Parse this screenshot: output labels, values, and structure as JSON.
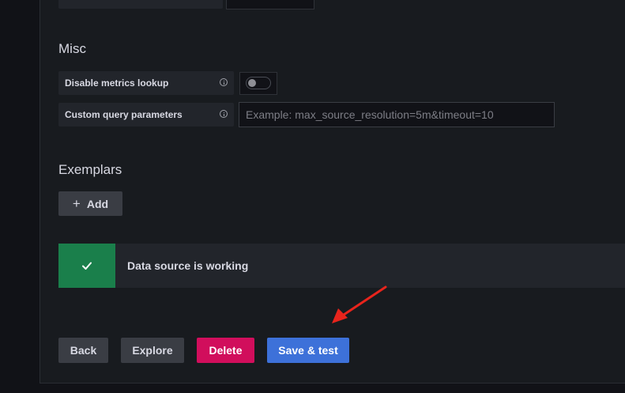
{
  "misc": {
    "title": "Misc",
    "disable_metrics_lookup_label": "Disable metrics lookup",
    "disable_metrics_lookup_enabled": false,
    "custom_query_label": "Custom query parameters",
    "custom_query_value": "",
    "custom_query_placeholder": "Example: max_source_resolution=5m&timeout=10"
  },
  "exemplars": {
    "title": "Exemplars",
    "add_label": "Add"
  },
  "status": {
    "message": "Data source is working",
    "color": "#1a7f4b"
  },
  "actions": {
    "back": "Back",
    "explore": "Explore",
    "delete": "Delete",
    "save_test": "Save & test"
  },
  "colors": {
    "primary": "#3d71d9",
    "danger": "#d10e5c",
    "success": "#1a7f4b",
    "annotation_arrow": "#e8241c"
  }
}
